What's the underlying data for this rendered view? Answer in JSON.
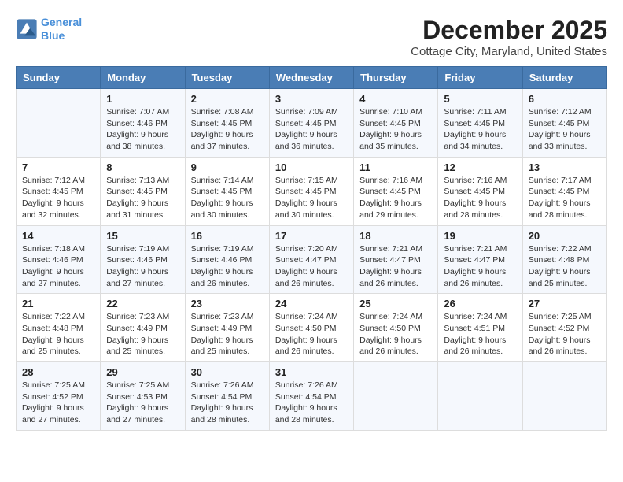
{
  "header": {
    "logo_line1": "General",
    "logo_line2": "Blue",
    "title": "December 2025",
    "subtitle": "Cottage City, Maryland, United States"
  },
  "columns": [
    "Sunday",
    "Monday",
    "Tuesday",
    "Wednesday",
    "Thursday",
    "Friday",
    "Saturday"
  ],
  "rows": [
    [
      {
        "day": "",
        "content": ""
      },
      {
        "day": "1",
        "content": "Sunrise: 7:07 AM\nSunset: 4:46 PM\nDaylight: 9 hours and 38 minutes."
      },
      {
        "day": "2",
        "content": "Sunrise: 7:08 AM\nSunset: 4:45 PM\nDaylight: 9 hours and 37 minutes."
      },
      {
        "day": "3",
        "content": "Sunrise: 7:09 AM\nSunset: 4:45 PM\nDaylight: 9 hours and 36 minutes."
      },
      {
        "day": "4",
        "content": "Sunrise: 7:10 AM\nSunset: 4:45 PM\nDaylight: 9 hours and 35 minutes."
      },
      {
        "day": "5",
        "content": "Sunrise: 7:11 AM\nSunset: 4:45 PM\nDaylight: 9 hours and 34 minutes."
      },
      {
        "day": "6",
        "content": "Sunrise: 7:12 AM\nSunset: 4:45 PM\nDaylight: 9 hours and 33 minutes."
      }
    ],
    [
      {
        "day": "7",
        "content": "Sunrise: 7:12 AM\nSunset: 4:45 PM\nDaylight: 9 hours and 32 minutes."
      },
      {
        "day": "8",
        "content": "Sunrise: 7:13 AM\nSunset: 4:45 PM\nDaylight: 9 hours and 31 minutes."
      },
      {
        "day": "9",
        "content": "Sunrise: 7:14 AM\nSunset: 4:45 PM\nDaylight: 9 hours and 30 minutes."
      },
      {
        "day": "10",
        "content": "Sunrise: 7:15 AM\nSunset: 4:45 PM\nDaylight: 9 hours and 30 minutes."
      },
      {
        "day": "11",
        "content": "Sunrise: 7:16 AM\nSunset: 4:45 PM\nDaylight: 9 hours and 29 minutes."
      },
      {
        "day": "12",
        "content": "Sunrise: 7:16 AM\nSunset: 4:45 PM\nDaylight: 9 hours and 28 minutes."
      },
      {
        "day": "13",
        "content": "Sunrise: 7:17 AM\nSunset: 4:45 PM\nDaylight: 9 hours and 28 minutes."
      }
    ],
    [
      {
        "day": "14",
        "content": "Sunrise: 7:18 AM\nSunset: 4:46 PM\nDaylight: 9 hours and 27 minutes."
      },
      {
        "day": "15",
        "content": "Sunrise: 7:19 AM\nSunset: 4:46 PM\nDaylight: 9 hours and 27 minutes."
      },
      {
        "day": "16",
        "content": "Sunrise: 7:19 AM\nSunset: 4:46 PM\nDaylight: 9 hours and 26 minutes."
      },
      {
        "day": "17",
        "content": "Sunrise: 7:20 AM\nSunset: 4:47 PM\nDaylight: 9 hours and 26 minutes."
      },
      {
        "day": "18",
        "content": "Sunrise: 7:21 AM\nSunset: 4:47 PM\nDaylight: 9 hours and 26 minutes."
      },
      {
        "day": "19",
        "content": "Sunrise: 7:21 AM\nSunset: 4:47 PM\nDaylight: 9 hours and 26 minutes."
      },
      {
        "day": "20",
        "content": "Sunrise: 7:22 AM\nSunset: 4:48 PM\nDaylight: 9 hours and 25 minutes."
      }
    ],
    [
      {
        "day": "21",
        "content": "Sunrise: 7:22 AM\nSunset: 4:48 PM\nDaylight: 9 hours and 25 minutes."
      },
      {
        "day": "22",
        "content": "Sunrise: 7:23 AM\nSunset: 4:49 PM\nDaylight: 9 hours and 25 minutes."
      },
      {
        "day": "23",
        "content": "Sunrise: 7:23 AM\nSunset: 4:49 PM\nDaylight: 9 hours and 25 minutes."
      },
      {
        "day": "24",
        "content": "Sunrise: 7:24 AM\nSunset: 4:50 PM\nDaylight: 9 hours and 26 minutes."
      },
      {
        "day": "25",
        "content": "Sunrise: 7:24 AM\nSunset: 4:50 PM\nDaylight: 9 hours and 26 minutes."
      },
      {
        "day": "26",
        "content": "Sunrise: 7:24 AM\nSunset: 4:51 PM\nDaylight: 9 hours and 26 minutes."
      },
      {
        "day": "27",
        "content": "Sunrise: 7:25 AM\nSunset: 4:52 PM\nDaylight: 9 hours and 26 minutes."
      }
    ],
    [
      {
        "day": "28",
        "content": "Sunrise: 7:25 AM\nSunset: 4:52 PM\nDaylight: 9 hours and 27 minutes."
      },
      {
        "day": "29",
        "content": "Sunrise: 7:25 AM\nSunset: 4:53 PM\nDaylight: 9 hours and 27 minutes."
      },
      {
        "day": "30",
        "content": "Sunrise: 7:26 AM\nSunset: 4:54 PM\nDaylight: 9 hours and 28 minutes."
      },
      {
        "day": "31",
        "content": "Sunrise: 7:26 AM\nSunset: 4:54 PM\nDaylight: 9 hours and 28 minutes."
      },
      {
        "day": "",
        "content": ""
      },
      {
        "day": "",
        "content": ""
      },
      {
        "day": "",
        "content": ""
      }
    ]
  ]
}
